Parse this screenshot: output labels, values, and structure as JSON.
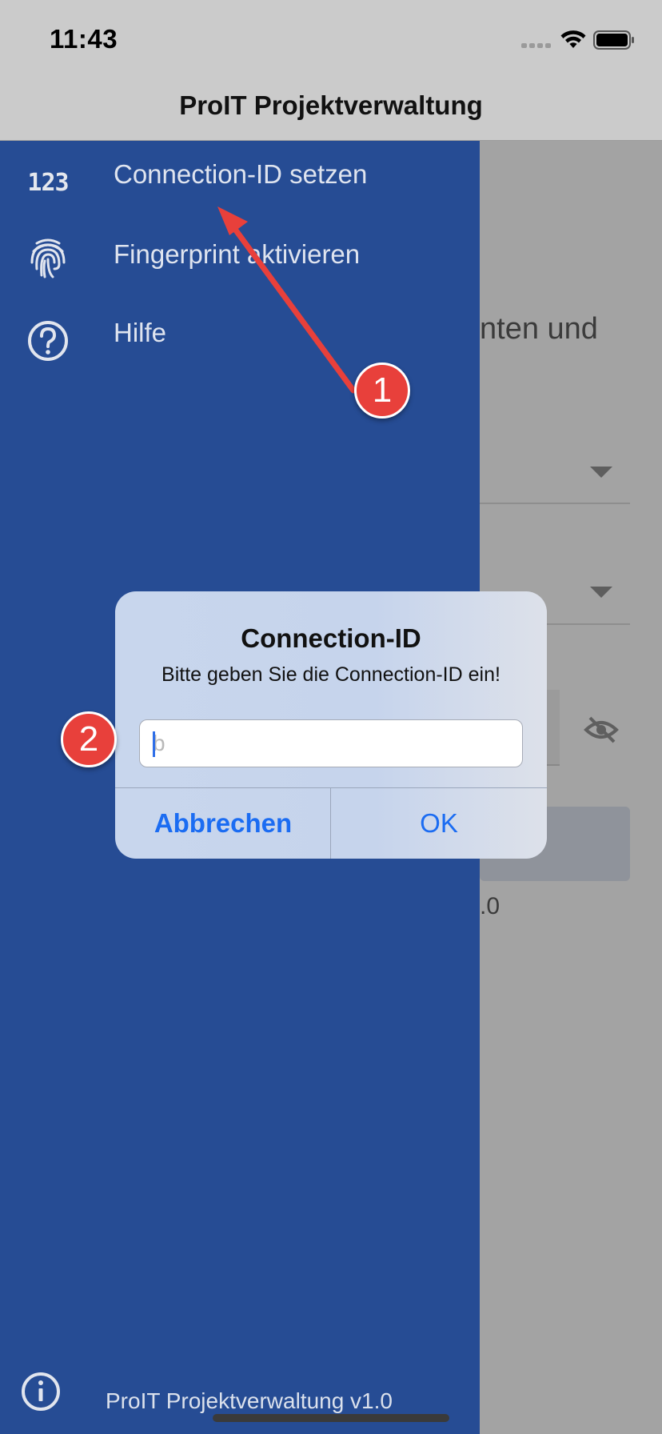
{
  "status": {
    "time": "11:43"
  },
  "nav": {
    "title": "ProIT Projektverwaltung"
  },
  "background": {
    "partial_text": "nten und",
    "partial_version": ".0"
  },
  "drawer": {
    "items": [
      {
        "icon": "numbers-icon",
        "icon_text": "123",
        "label": "Connection-ID setzen"
      },
      {
        "icon": "fingerprint-icon",
        "label": "Fingerprint aktivieren"
      },
      {
        "icon": "help-icon",
        "label": "Hilfe"
      }
    ],
    "footer": "ProIT Projektverwaltung v1.0"
  },
  "annotations": {
    "badge1": "1",
    "badge2": "2",
    "arrow_color": "#e8403b"
  },
  "dialog": {
    "title": "Connection-ID",
    "message": "Bitte geben Sie die Connection-ID ein!",
    "input_value": "",
    "input_placeholder": "b",
    "cancel_label": "Abbrechen",
    "ok_label": "OK"
  },
  "colors": {
    "drawer": "#264c94",
    "accent": "#1b6cf2",
    "badge": "#e8403b"
  }
}
